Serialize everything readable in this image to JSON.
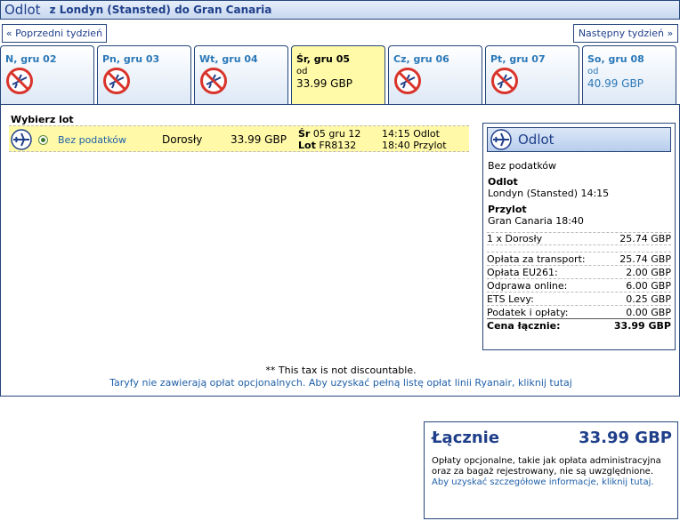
{
  "header": {
    "title": "Odlot",
    "route": "z Londyn (Stansted) do Gran Canaria"
  },
  "nav": {
    "prev_week": "« Poprzedni tydzień",
    "next_week": "Następny tydzień »"
  },
  "tabs": [
    {
      "label": "N, gru 02",
      "available": false
    },
    {
      "label": "Pn, gru 03",
      "available": false
    },
    {
      "label": "Wt, gru 04",
      "available": false
    },
    {
      "label": "Śr, gru 05",
      "available": true,
      "active": true,
      "from": "od",
      "price": "33.99 GBP"
    },
    {
      "label": "Cz, gru 06",
      "available": false
    },
    {
      "label": "Pt, gru 07",
      "available": false
    },
    {
      "label": "So, gru 08",
      "available": true,
      "from": "od",
      "price": "40.99 GBP"
    }
  ],
  "flights": {
    "title": "Wybierz lot",
    "row": {
      "fare": "Bez podatków",
      "passenger": "Dorosły",
      "price": "33.99 GBP",
      "day_label": "Śr",
      "date": "05 gru 12",
      "flight_label": "Lot",
      "flight_no": "FR8132",
      "dep_time": "14:15",
      "dep_label": "Odlot",
      "arr_time": "18:40",
      "arr_label": "Przylot"
    }
  },
  "summary": {
    "title": "Odlot",
    "fare": "Bez podatków",
    "dep_heading": "Odlot",
    "dep_detail": "Londyn (Stansted) 14:15",
    "arr_heading": "Przylot",
    "arr_detail": "Gran Canaria 18:40",
    "pax_label": "1 x Dorosły",
    "pax_value": "25.74 GBP",
    "fees": [
      {
        "label": "Opłata za transport:",
        "value": "25.74 GBP"
      },
      {
        "label": "Opłata EU261:",
        "value": "2.00 GBP"
      },
      {
        "label": "Odprawa online:",
        "value": "6.00 GBP"
      },
      {
        "label": "ETS Levy:",
        "value": "0.25 GBP"
      },
      {
        "label": "Podatek i opłaty:",
        "value": "0.00 GBP"
      }
    ],
    "total_label": "Cena łącznie:",
    "total_value": "33.99 GBP"
  },
  "notes": {
    "tax": "** This tax is not discountable.",
    "fees_link": "Taryfy nie zawierają opłat opcjonalnych. Aby uzyskać pełną listę opłat linii Ryanair, kliknij tutaj"
  },
  "total": {
    "label": "Łącznie",
    "amount": "33.99 GBP",
    "text": "Opłaty opcjonalne, takie jak opłata administracyjna oraz za bagaż rejestrowany, nie są uwzględnione.",
    "link": "Aby uzyskać szczegółowe informacje, kliknij tutaj."
  },
  "colors": {
    "brand": "#1f3f8a",
    "link": "#1f5fa8",
    "highlight": "#fff9a8",
    "noflight": "#d9342b"
  }
}
